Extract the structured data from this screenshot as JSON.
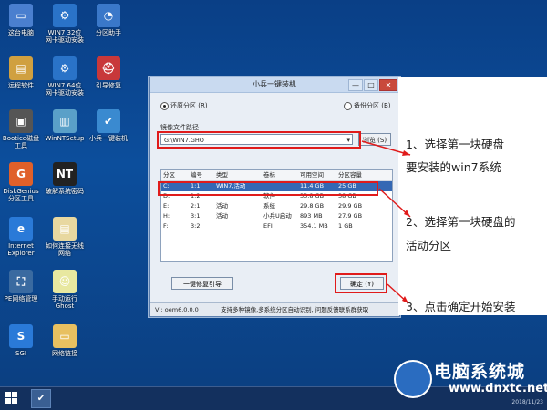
{
  "desktop_icons": [
    {
      "label": "这台电脑",
      "color": "#4a7fcf",
      "glyph": "▭",
      "col": 0,
      "row": 0
    },
    {
      "label": "WIN7 32位 网卡驱动安装",
      "color": "#2a73c8",
      "glyph": "⚙",
      "col": 1,
      "row": 0
    },
    {
      "label": "分区助手",
      "color": "#3a78c9",
      "glyph": "◔",
      "col": 2,
      "row": 0
    },
    {
      "label": "远程软件",
      "color": "#d0a040",
      "glyph": "▤",
      "col": 0,
      "row": 1
    },
    {
      "label": "WIN7 64位 网卡驱动安装",
      "color": "#2a73c8",
      "glyph": "⚙",
      "col": 1,
      "row": 1
    },
    {
      "label": "引导修复",
      "color": "#c8383a",
      "glyph": "⛑",
      "col": 2,
      "row": 1
    },
    {
      "label": "Bootice磁盘工具",
      "color": "#555555",
      "glyph": "▣",
      "col": 0,
      "row": 2
    },
    {
      "label": "WinNTSetup",
      "color": "#5aa0c8",
      "glyph": "▥",
      "col": 1,
      "row": 2
    },
    {
      "label": "小兵一键装机",
      "color": "#3a8ad0",
      "glyph": "✔",
      "col": 2,
      "row": 2
    },
    {
      "label": "DiskGenius分区工具",
      "color": "#e0602a",
      "glyph": "G",
      "col": 0,
      "row": 3
    },
    {
      "label": "破解系统密码",
      "color": "#222222",
      "glyph": "NT",
      "col": 1,
      "row": 3
    },
    {
      "label": "Internet Explorer",
      "color": "#2a7ad8",
      "glyph": "e",
      "col": 0,
      "row": 4
    },
    {
      "label": "如何连接无线网络",
      "color": "#e8d8a0",
      "glyph": "▤",
      "col": 1,
      "row": 4
    },
    {
      "label": "PE网络管理",
      "color": "#3a6aa0",
      "glyph": "⛶",
      "col": 0,
      "row": 5
    },
    {
      "label": "手动运行Ghost",
      "color": "#e8e8a0",
      "glyph": "☺",
      "col": 1,
      "row": 5
    },
    {
      "label": "SGI",
      "color": "#2a7ad8",
      "glyph": "S",
      "col": 0,
      "row": 6
    },
    {
      "label": "网络链接",
      "color": "#e8c060",
      "glyph": "▭",
      "col": 1,
      "row": 6
    }
  ],
  "window": {
    "title": "小兵一键装机",
    "min": "—",
    "max": "□",
    "close": "✕",
    "restore_label": "还原分区 (R)",
    "backup_label": "备份分区 (B)",
    "path_label": "镜像文件路径",
    "path_value": "G:\\WIN7.GHO",
    "dropdown_arrow": "▾",
    "browse_label": "浏览 (S)",
    "table": {
      "headers": [
        "分区",
        "编号",
        "类型",
        "卷标",
        "可用空间",
        "分区容量"
      ],
      "rows": [
        [
          "C:",
          "1:1",
          "WIN7,活动",
          "",
          "11.4 GB",
          "25 GB"
        ],
        [
          "D:",
          "1:2",
          "",
          "软件",
          "33.8 GB",
          "38 GB"
        ],
        [
          "E:",
          "2:1",
          "活动",
          "系统",
          "29.8 GB",
          "29.9 GB"
        ],
        [
          "H:",
          "3:1",
          "活动",
          "小兵U启动",
          "893 MB",
          "27.9 GB"
        ],
        [
          "F:",
          "3:2",
          "",
          "EFI",
          "354.1 MB",
          "1 GB"
        ]
      ],
      "selected_row": 0
    },
    "repair_label": "一键修复引导",
    "ok_label": "确定 (Y)",
    "status_version": "V : oem6.0.0.0",
    "status_text": "支持多种镜像,多系统分区自动识别, 问题反馈联系群获取"
  },
  "annotations": {
    "step1_line1": "1、选择第一块硬盘",
    "step1_line2": "要安装的win7系统",
    "step2_line1": "2、选择第一块硬盘的",
    "step2_line2": "活动分区",
    "step3": "3、点击确定开始安装"
  },
  "taskbar": {
    "start_icon": "windows-icon",
    "task_glyph": "✔",
    "clock": "2018/11/23"
  },
  "watermark": {
    "title": "电脑系统城",
    "url": "www.dnxtc.net"
  },
  "colors": {
    "desktop": "#0c4e9c",
    "highlight": "#e01b1b",
    "selection": "#3468b4"
  }
}
